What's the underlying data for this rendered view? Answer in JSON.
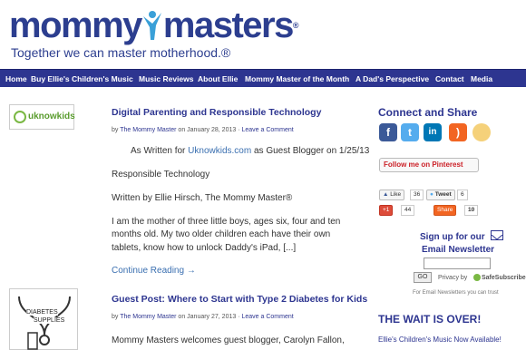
{
  "header": {
    "logo_part1": "mommy",
    "logo_part2": "masters",
    "logo_reg": "®",
    "tagline": "Together we can master motherhood.®"
  },
  "nav": {
    "items": [
      "Home",
      "Buy Ellie's Children's Music",
      "Music Reviews",
      "About Ellie",
      "Mommy Master of the Month",
      "A Dad's Perspective",
      "Contact",
      "Media"
    ]
  },
  "posts": [
    {
      "thumb_label": "uknowkids",
      "title": "Digital Parenting and Responsible Technology",
      "meta_by": "by",
      "meta_author": "The Mommy Master",
      "meta_on": "on January 28, 2013 ·",
      "meta_comments": "Leave a Comment",
      "line1_pre": "As Written for ",
      "line1_link": "Uknowkids.com",
      "line1_post": " as Guest Blogger on 1/25/13",
      "line2": "Responsible Technology",
      "line3": "Written by Ellie Hirsch, The Mommy Master®",
      "line4": "I am the mother of three little boys, ages six, four and ten",
      "line5": "months old.  My two older children each have their own",
      "line6": "tablets, know how to unlock Daddy's iPad, [...]",
      "continue": "Continue Reading →"
    },
    {
      "thumb_label_1": "DIABETES",
      "thumb_label_2": "SUPPLIES",
      "title": "Guest Post: Where to Start with Type 2 Diabetes for Kids",
      "meta_by": "by",
      "meta_author": "The Mommy Master",
      "meta_on": "on January 27, 2013 ·",
      "meta_comments": "Leave a Comment",
      "line1": "Mommy Masters welcomes guest blogger, Carolyn Fallon,"
    }
  ],
  "sidebar": {
    "connect_title": "Connect and Share",
    "pinterest_label": "Follow me on Pinterest",
    "like_label": "Like",
    "like_count": "36",
    "tweet_label": "Tweet",
    "tweet_count": "6",
    "gplus_label": "+1",
    "gplus_count": "44",
    "share_label": "Share",
    "share_count": "10",
    "newsletter_line1": "Sign up for our",
    "newsletter_line2": "Email Newsletter",
    "go_label": "GO",
    "privacy_label": "Privacy by",
    "safesubscribe": "SafeSubscribe",
    "privacy_note": "For Email Newsletters you can trust",
    "wait_title": "THE WAIT IS OVER!",
    "wait_sub": "Ellie's Children's Music Now Available!"
  },
  "colors": {
    "brand_blue": "#2d3590",
    "link_blue": "#3a6fb0",
    "pinterest_red": "#cb2027"
  }
}
